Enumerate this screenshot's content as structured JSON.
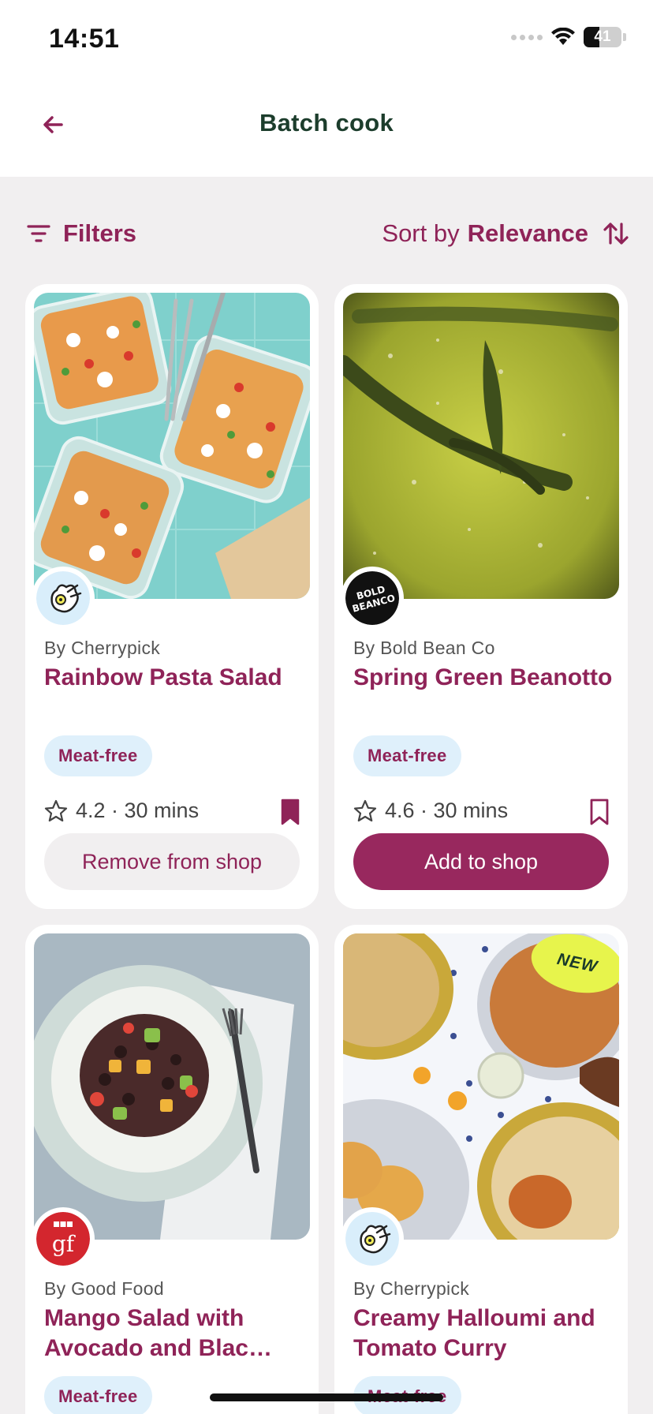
{
  "status": {
    "time": "14:51",
    "battery": "41",
    "battery_level": 0.41
  },
  "header": {
    "title": "Batch cook",
    "back_icon": "arrow-left-icon"
  },
  "toolbar": {
    "filters_label": "Filters",
    "sort_prefix": "Sort by",
    "sort_value": "Relevance"
  },
  "colors": {
    "brand": "#8f2358",
    "button": "#98285e",
    "tag_bg": "#dff0fb",
    "title_green": "#1c3d2c",
    "new_badge": "#e7f44c"
  },
  "cards": [
    {
      "source": "By Cherrypick",
      "title": "Rainbow Pasta Salad",
      "tag": "Meat-free",
      "meta": "4.2 · 30 mins",
      "saved": true,
      "shop_label": "Remove from shop"
    },
    {
      "source": "By Bold Bean Co",
      "title": "Spring Green Beanotto",
      "tag": "Meat-free",
      "meta": "4.6 · 30 mins",
      "saved": false,
      "shop_label": "Add to shop",
      "logo_text": "BOLD BEANCO"
    },
    {
      "source": "By Good Food",
      "title": "Mango Salad with Avocado and Blac…",
      "tag": "Meat-free",
      "logo_text": "BBC gf"
    },
    {
      "source": "By Cherrypick",
      "title": "Creamy Halloumi and Tomato Curry",
      "tag": "Meat-free",
      "badge": "NEW"
    }
  ]
}
